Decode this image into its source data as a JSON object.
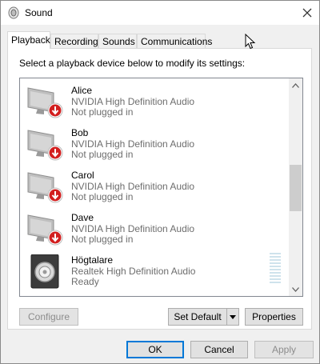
{
  "window": {
    "title": "Sound",
    "close_symbol": "✕"
  },
  "tabs": [
    {
      "label": "Playback",
      "active": true
    },
    {
      "label": "Recording",
      "active": false
    },
    {
      "label": "Sounds",
      "active": false
    },
    {
      "label": "Communications",
      "active": false
    }
  ],
  "playback": {
    "instruction": "Select a playback device below to modify its settings:",
    "devices": [
      {
        "name": "Alice",
        "driver": "NVIDIA High Definition Audio",
        "status": "Not plugged in",
        "icon": "monitor-unplugged-icon"
      },
      {
        "name": "Bob",
        "driver": "NVIDIA High Definition Audio",
        "status": "Not plugged in",
        "icon": "monitor-unplugged-icon"
      },
      {
        "name": "Carol",
        "driver": "NVIDIA High Definition Audio",
        "status": "Not plugged in",
        "icon": "monitor-unplugged-icon"
      },
      {
        "name": "Dave",
        "driver": "NVIDIA High Definition Audio",
        "status": "Not plugged in",
        "icon": "monitor-unplugged-icon"
      },
      {
        "name": "Högtalare",
        "driver": "Realtek High Definition Audio",
        "status": "Ready",
        "icon": "speaker-icon"
      }
    ],
    "buttons": {
      "configure": "Configure",
      "set_default": "Set Default",
      "properties": "Properties"
    }
  },
  "footer": {
    "ok": "OK",
    "cancel": "Cancel",
    "apply": "Apply"
  },
  "colors": {
    "accent": "#0078d7",
    "unplugged_badge": "#d21f1f",
    "secondary_text": "#6d6d6d"
  }
}
